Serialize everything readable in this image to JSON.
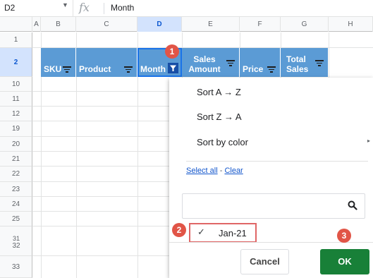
{
  "formula_bar": {
    "cell_ref": "D2",
    "fx_label": "fx",
    "value": "Month"
  },
  "columns": [
    "A",
    "B",
    "C",
    "D",
    "E",
    "F",
    "G",
    "H"
  ],
  "row_numbers": [
    "1",
    "2",
    "10",
    "11",
    "12",
    "19",
    "20",
    "21",
    "22",
    "23",
    "24",
    "25",
    "32",
    "33"
  ],
  "row_number_extra": "31",
  "headers": {
    "sku": "SKU",
    "product": "Product",
    "month": "Month",
    "sales_amount": "Sales Amount",
    "price": "Price",
    "total_sales": "Total Sales"
  },
  "menu": {
    "sort_az": "Sort A → Z",
    "sort_za": "Sort Z → A",
    "sort_by_color": "Sort by color",
    "submenu_arrow": "▸",
    "select_all": "Select all",
    "separator": "-",
    "clear": "Clear",
    "search_placeholder": "",
    "checkmark": "✓",
    "filter_value": "Jan-21",
    "cancel": "Cancel",
    "ok": "OK"
  },
  "badges": [
    "1",
    "2",
    "3"
  ],
  "colors": {
    "header_fill": "#5b9bd5",
    "ok_button": "#188038",
    "badge": "#e15547",
    "link": "#1155cc"
  }
}
